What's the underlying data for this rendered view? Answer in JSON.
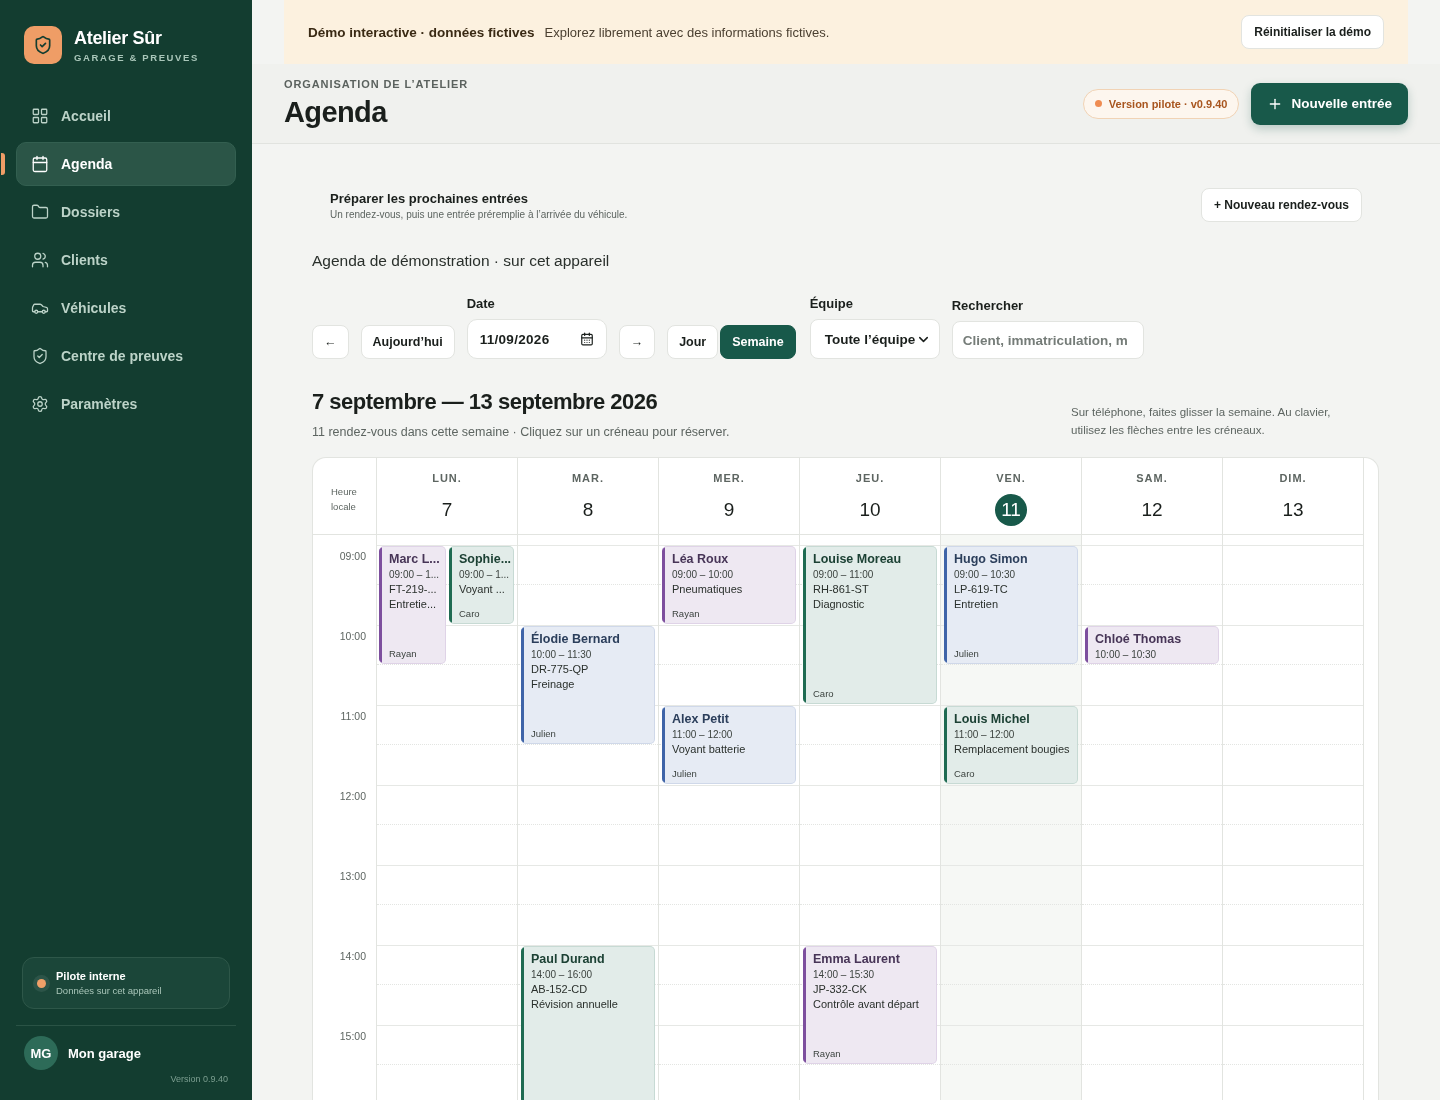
{
  "sidebar": {
    "brand": {
      "name": "Atelier Sûr",
      "tagline": "GARAGE & PREUVES"
    },
    "items": [
      {
        "label": "Accueil",
        "selected": false
      },
      {
        "label": "Agenda",
        "selected": true
      },
      {
        "label": "Dossiers",
        "selected": false
      },
      {
        "label": "Clients",
        "selected": false
      },
      {
        "label": "Véhicules",
        "selected": false
      },
      {
        "label": "Centre de preuves",
        "selected": false
      },
      {
        "label": "Paramètres",
        "selected": false
      }
    ],
    "status": {
      "title": "Pilote interne",
      "subtitle": "Données sur cet appareil",
      "color": "#f0a068"
    },
    "user": {
      "initials": "MG",
      "name": "Mon garage"
    },
    "version": "Version 0.9.40"
  },
  "banner": {
    "title": "Démo interactive · données fictives",
    "text": "Explorez librement avec des informations fictives.",
    "button": "Réinitialiser la démo"
  },
  "header": {
    "eyebrow": "ORGANISATION DE L’ATELIER",
    "title": "Agenda",
    "badge": "Version pilote · v0.9.40",
    "button": "Nouvelle entrée"
  },
  "prepare": {
    "title": "Préparer les prochaines entrées",
    "subtitle": "Un rendez-vous, puis une entrée préremplie à l’arrivée du véhicule.",
    "button": "+ Nouveau rendez-vous"
  },
  "agenda_label": "Agenda de démonstration · sur cet appareil",
  "toolbar": {
    "prev": "←",
    "today": "Aujourd’hui",
    "date_label": "Date",
    "date": "11/09/2026",
    "next": "→",
    "views": [
      {
        "label": "Jour",
        "selected": false
      },
      {
        "label": "Semaine",
        "selected": true
      }
    ],
    "team_label": "Équipe",
    "team": "Toute l’équipe",
    "search_label": "Rechercher",
    "search_placeholder": "Client, immatriculation, m"
  },
  "week": {
    "title": "7 septembre — 13 septembre 2026",
    "subtitle": "11 rendez-vous dans cette semaine · Cliquez sur un créneau pour réserver.",
    "hint": "Sur téléphone, faites glisser la semaine. Au clavier, utilisez les flèches entre les créneaux."
  },
  "calendar": {
    "time_header": "Heure locale",
    "hours": [
      "09:00",
      "10:00",
      "11:00",
      "12:00",
      "13:00",
      "14:00",
      "15:00"
    ],
    "days": [
      {
        "weekday": "LUN.",
        "day": "7",
        "today": false,
        "events": [
          {
            "name": "Marc L...",
            "time": "09:00 – 1...",
            "plate": "FT-219-...",
            "service": "Entretie...",
            "tech": "Rayan",
            "overlap": true,
            "half_hour_longer": true,
            "color": "#7d4f9e"
          },
          {
            "name": "Sophie...",
            "time": "09:00 – 1...",
            "service": "Voyant ...",
            "tech": "Caro",
            "overlap": true,
            "half_hour_longer": false,
            "color": "#1f6b52"
          }
        ]
      },
      {
        "weekday": "MAR.",
        "day": "8",
        "today": false,
        "events": [
          {
            "name": "Élodie Bernard",
            "time": "10:00 – 11:30",
            "plate": "DR-775-QP",
            "service": "Freinage",
            "tech": "Julien",
            "overlap": false,
            "color": "#3f64a8"
          },
          {
            "name": "Paul Durand",
            "time": "14:00 – 16:00",
            "plate": "AB-152-CD",
            "service": "Révision annuelle",
            "overlap": false,
            "color": "#1f6b52"
          }
        ]
      },
      {
        "weekday": "MER.",
        "day": "9",
        "today": false,
        "events": [
          {
            "name": "Léa Roux",
            "time": "09:00 – 10:00",
            "service": "Pneumatiques",
            "tech": "Rayan",
            "overlap": false,
            "color": "#7d4f9e"
          },
          {
            "name": "Alex Petit",
            "time": "11:00 – 12:00",
            "service": "Voyant batterie",
            "tech": "Julien",
            "overlap": false,
            "color": "#3f64a8"
          }
        ]
      },
      {
        "weekday": "JEU.",
        "day": "10",
        "today": false,
        "events": [
          {
            "name": "Louise Moreau",
            "time": "09:00 – 11:00",
            "plate": "RH-861-ST",
            "service": "Diagnostic",
            "tech": "Caro",
            "overlap": false,
            "color": "#1f6b52"
          },
          {
            "name": "Emma Laurent",
            "time": "14:00 – 15:30",
            "plate": "JP-332-CK",
            "service": "Contrôle avant départ",
            "tech": "Rayan",
            "overlap": false,
            "color": "#7d4f9e"
          }
        ]
      },
      {
        "weekday": "VEN.",
        "day": "11",
        "today": true,
        "events": [
          {
            "name": "Hugo Simon",
            "time": "09:00 – 10:30",
            "plate": "LP-619-TC",
            "service": "Entretien",
            "tech": "Julien",
            "overlap": false,
            "color": "#3f64a8"
          },
          {
            "name": "Louis Michel",
            "time": "11:00 – 12:00",
            "service": "Remplacement bougies",
            "tech": "Caro",
            "overlap": false,
            "color": "#1f6b52"
          }
        ]
      },
      {
        "weekday": "SAM.",
        "day": "12",
        "today": false,
        "events": [
          {
            "name": "Chloé Thomas",
            "time": "10:00 – 10:30",
            "overlap": false,
            "color": "#7d4f9e"
          }
        ]
      },
      {
        "weekday": "DIM.",
        "day": "13",
        "today": false
      }
    ]
  }
}
